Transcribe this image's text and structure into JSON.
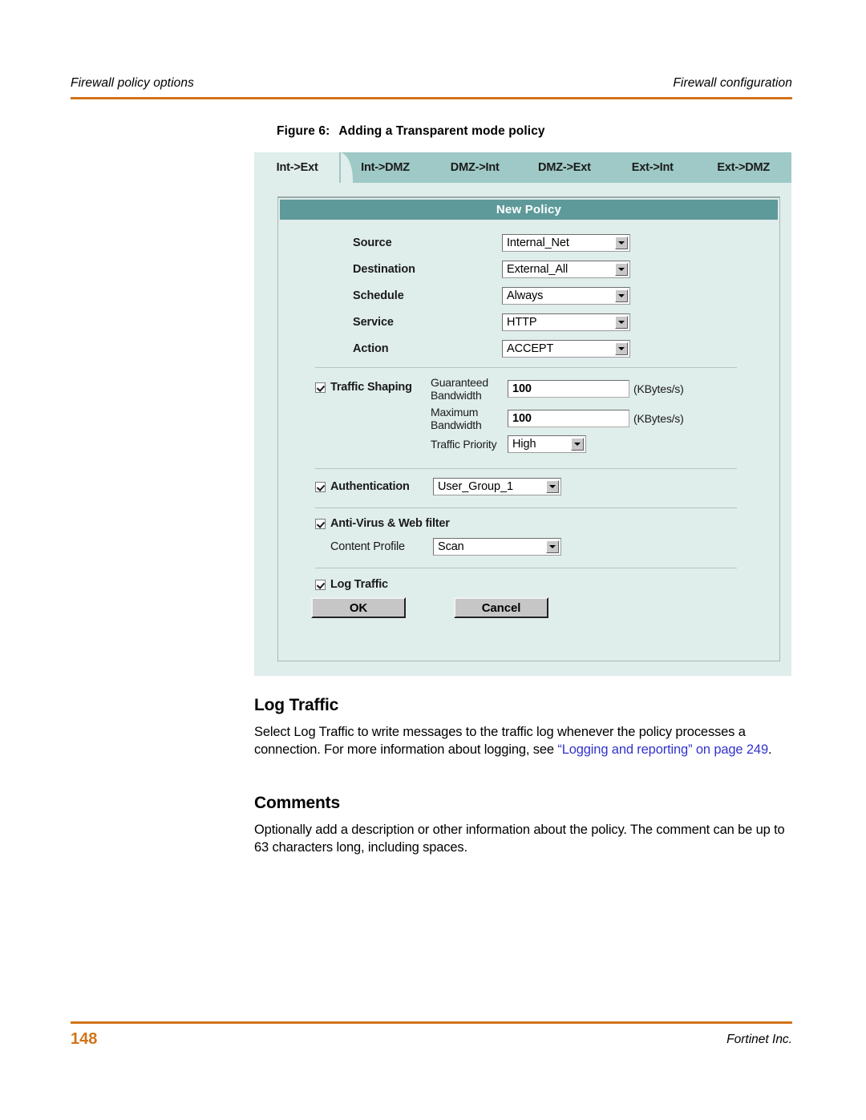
{
  "header": {
    "left": "Firewall policy options",
    "right": "Firewall configuration",
    "rule_color": "#d2741a"
  },
  "figure": {
    "caption_number": "Figure 6:",
    "caption_text": "Adding a Transparent mode policy",
    "tabs": [
      {
        "label": "Int->Ext",
        "active": true
      },
      {
        "label": "Int->DMZ",
        "active": false
      },
      {
        "label": "DMZ->Int",
        "active": false
      },
      {
        "label": "DMZ->Ext",
        "active": false
      },
      {
        "label": "Ext->Int",
        "active": false
      },
      {
        "label": "Ext->DMZ",
        "active": false
      }
    ],
    "panel_title": "New Policy",
    "fields": [
      {
        "label": "Source",
        "value": "Internal_Net"
      },
      {
        "label": "Destination",
        "value": "External_All"
      },
      {
        "label": "Schedule",
        "value": "Always"
      },
      {
        "label": "Service",
        "value": "HTTP"
      },
      {
        "label": "Action",
        "value": "ACCEPT"
      }
    ],
    "traffic_shaping": {
      "title": "Traffic Shaping",
      "checked": true,
      "guaranteed_label": "Guaranteed Bandwidth",
      "guaranteed_value": "100",
      "guaranteed_unit": "(KBytes/s)",
      "maximum_label": "Maximum Bandwidth",
      "maximum_value": "100",
      "maximum_unit": "(KBytes/s)",
      "priority_label": "Traffic Priority",
      "priority_value": "High"
    },
    "authentication": {
      "title": "Authentication",
      "checked": true,
      "value": "User_Group_1"
    },
    "antivirus": {
      "title": "Anti-Virus & Web filter",
      "checked": true,
      "content_profile_label": "Content Profile",
      "content_profile_value": "Scan"
    },
    "log_traffic": {
      "title": "Log Traffic",
      "checked": true
    },
    "buttons": {
      "ok": "OK",
      "cancel": "Cancel"
    },
    "colors": {
      "tab_inactive": "#9ec9c6",
      "tab_active": "#dfedeb",
      "panel_bg": "#dfedeb",
      "title_bar": "#5f9a9a"
    }
  },
  "sections": {
    "log_traffic": {
      "heading": "Log Traffic",
      "body_1": "Select Log Traffic to write messages to the traffic log whenever the policy processes a connection. For more information about logging, see ",
      "link": "“Logging and reporting” on page 249",
      "body_2": "."
    },
    "comments": {
      "heading": "Comments",
      "body": "Optionally add a description or other information about the policy. The comment can be up to 63 characters long, including spaces."
    }
  },
  "footer": {
    "page_number": "148",
    "brand": "Fortinet Inc."
  }
}
